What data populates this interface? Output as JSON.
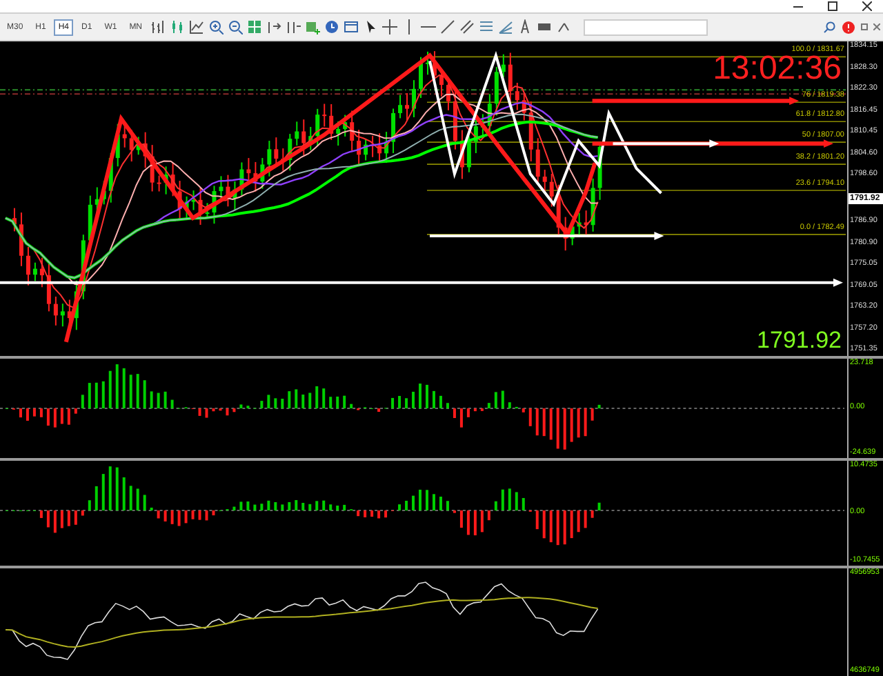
{
  "toolbar": {
    "timeframes": [
      {
        "label": "M30",
        "selected": false
      },
      {
        "label": "H1",
        "selected": false
      },
      {
        "label": "H4",
        "selected": true
      },
      {
        "label": "D1",
        "selected": false
      },
      {
        "label": "W1",
        "selected": false
      },
      {
        "label": "MN",
        "selected": false
      }
    ]
  },
  "chart": {
    "clock": "13:02:36",
    "price_label": "1791.92",
    "price_axis": [
      {
        "label": "1834.15",
        "kind": "tick"
      },
      {
        "label": "1828.30",
        "kind": "tick"
      },
      {
        "label": "1822.30",
        "kind": "tick"
      },
      {
        "label": "1816.45",
        "kind": "tick"
      },
      {
        "label": "1810.45",
        "kind": "tick"
      },
      {
        "label": "1804.60",
        "kind": "tick"
      },
      {
        "label": "1798.60",
        "kind": "tick"
      },
      {
        "label": "1791.92",
        "kind": "current"
      },
      {
        "label": "1786.90",
        "kind": "tick"
      },
      {
        "label": "1780.90",
        "kind": "tick"
      },
      {
        "label": "1775.05",
        "kind": "tick"
      },
      {
        "label": "1769.05",
        "kind": "tick"
      },
      {
        "label": "1763.20",
        "kind": "tick"
      },
      {
        "label": "1757.20",
        "kind": "tick"
      },
      {
        "label": "1751.35",
        "kind": "tick"
      }
    ],
    "fib_levels": [
      {
        "label": "100.0 / 1831.67"
      },
      {
        "label": "76 / 1819.38"
      },
      {
        "label": "61.8 / 1812.80"
      },
      {
        "label": "50 / 1807.00"
      },
      {
        "label": "38.2 / 1801.20"
      },
      {
        "label": "23.6 / 1794.10"
      },
      {
        "label": "0.0 / 1782.49"
      }
    ]
  },
  "indicators": [
    {
      "kind": "histogram",
      "axis": [
        "23.718",
        "0.00",
        "-24.639"
      ]
    },
    {
      "kind": "histogram",
      "axis": [
        "10.4735",
        "0.00",
        "-10.7455"
      ]
    },
    {
      "kind": "line",
      "axis": [
        "4956953",
        "4636749"
      ]
    }
  ]
}
